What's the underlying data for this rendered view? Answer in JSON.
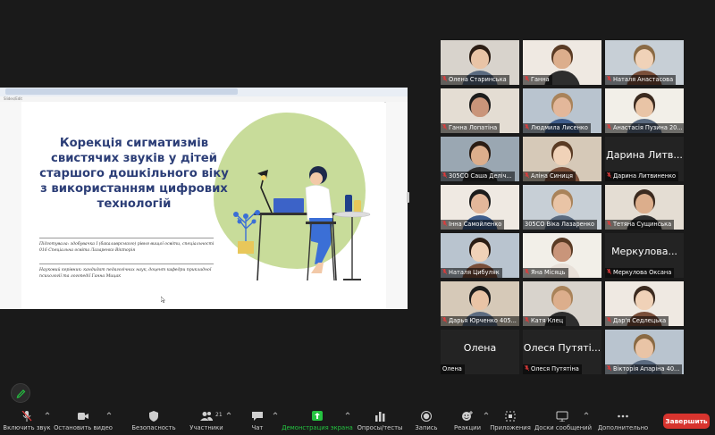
{
  "shared_screen": {
    "browser_crumb": "Slides/Edit",
    "slide": {
      "title": "Корекція сигматизмів свистячих звуків у дітей старшого дошкільного віку з використанням цифрових технологій",
      "subtitle_1": "Підготувала: здобувачка І (бакалаврського) рівня вищої освіти, спеціальності 016 Спеціальна освіта Лазаренко Вікторія",
      "subtitle_2": "Науковий керівник: кандидат педагогічних наук, доцент кафедри прикладної психології та логопедії Ганна Мицак"
    }
  },
  "participants": [
    {
      "name": "Олена Старинська",
      "muted": true,
      "video": true
    },
    {
      "name": "Ганна",
      "muted": true,
      "video": true
    },
    {
      "name": "Наталя Анастасова",
      "muted": true,
      "video": true
    },
    {
      "name": "Ганна Лопатіна",
      "muted": true,
      "video": true
    },
    {
      "name": "Людмила Лисенко",
      "muted": true,
      "video": true
    },
    {
      "name": "Анастасія Пузина 20...",
      "muted": true,
      "video": true
    },
    {
      "name": "305СО Саша Деліч...",
      "muted": true,
      "video": true
    },
    {
      "name": "Аліна Синиця",
      "muted": true,
      "video": true
    },
    {
      "name": "Дарина Литвиненко",
      "display": "Дарина Литв...",
      "muted": true,
      "video": false
    },
    {
      "name": "Інна Самойленко",
      "muted": true,
      "video": true
    },
    {
      "name": "305СО Віка Лазаренко",
      "muted": false,
      "video": true,
      "active": true
    },
    {
      "name": "Тетяна Сущинська",
      "muted": true,
      "video": true
    },
    {
      "name": "Наталя Цибуляк",
      "muted": true,
      "video": true
    },
    {
      "name": "Яна Місяць",
      "muted": true,
      "video": true
    },
    {
      "name": "Меркулова Оксана",
      "display": "Меркулова...",
      "muted": true,
      "video": false
    },
    {
      "name": "Дарья Юрченко 405...",
      "muted": true,
      "video": true
    },
    {
      "name": "Катя Клец",
      "muted": true,
      "video": true
    },
    {
      "name": "Дар'я Седлецька",
      "muted": true,
      "video": true
    },
    {
      "name": "Олена",
      "display": "Олена",
      "muted": false,
      "video": false
    },
    {
      "name": "Олеся Путятіна",
      "display": "Олеся Путяті...",
      "muted": true,
      "video": false
    },
    {
      "name": "Вікторія Апаріна 40...",
      "muted": true,
      "video": true
    }
  ],
  "toolbar": {
    "unmute": "Включить звук",
    "stop_video": "Остановить видео",
    "security": "Безопасность",
    "participants": "Участники",
    "participants_count": "21",
    "chat": "Чат",
    "share_screen": "Демонстрация экрана",
    "polls": "Опросы/тесты",
    "record": "Запись",
    "reactions": "Реакции",
    "apps": "Приложения",
    "whiteboards": "Доски сообщений",
    "more": "Дополнительно",
    "end": "Завершить"
  },
  "colors": {
    "end_button": "#d7342e",
    "share_green": "#25c441",
    "active_speaker": "#2ea043",
    "slide_title": "#2c3e77",
    "slide_blob": "#c8dc9a"
  }
}
